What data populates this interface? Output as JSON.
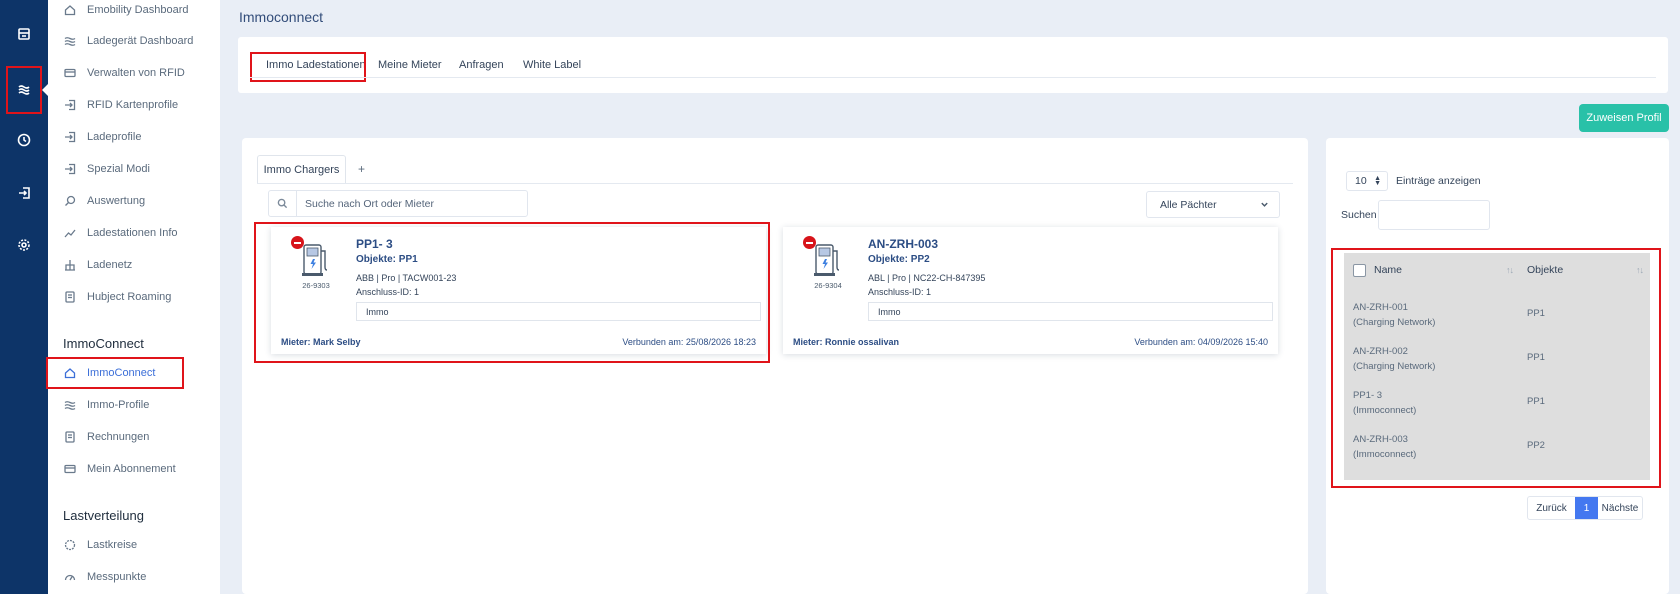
{
  "sidebar": {
    "items": [
      {
        "label": "Emobility Dashboard",
        "icon": "home-icon"
      },
      {
        "label": "Ladegerät Dashboard",
        "icon": "waves-icon"
      },
      {
        "label": "Verwalten von RFID",
        "icon": "card-icon"
      },
      {
        "label": "RFID Kartenprofile",
        "icon": "login-icon"
      },
      {
        "label": "Ladeprofile",
        "icon": "login-icon"
      },
      {
        "label": "Spezial Modi",
        "icon": "login-icon"
      },
      {
        "label": "Auswertung",
        "icon": "search-icon"
      },
      {
        "label": "Ladestationen Info",
        "icon": "trend-icon"
      },
      {
        "label": "Ladenetz",
        "icon": "network-icon"
      },
      {
        "label": "Hubject Roaming",
        "icon": "document-icon"
      }
    ],
    "immo_section": "ImmoConnect",
    "immo_items": [
      {
        "label": "ImmoConnect",
        "icon": "home-icon"
      },
      {
        "label": "Immo-Profile",
        "icon": "waves-icon"
      },
      {
        "label": "Rechnungen",
        "icon": "document-icon"
      },
      {
        "label": "Mein Abonnement",
        "icon": "card-icon"
      }
    ],
    "last_section": "Lastverteilung",
    "last_items": [
      {
        "label": "Lastkreise",
        "icon": "circle-icon"
      },
      {
        "label": "Messpunkte",
        "icon": "gauge-icon"
      }
    ]
  },
  "page": {
    "title": "Immoconnect"
  },
  "tabs": [
    "Immo Ladestationen",
    "Meine Mieter",
    "Anfragen",
    "White Label"
  ],
  "assign_button": "Zuweisen Profil",
  "main": {
    "tab": "Immo Chargers",
    "tab_add": "+",
    "search_placeholder": "Suche nach Ort oder Mieter",
    "filter": "Alle Pächter"
  },
  "chargers": [
    {
      "id": "26-9303",
      "title": "PP1- 3",
      "objects": "Objekte: PP1",
      "model": "ABB | Pro | TACW001-23",
      "connection": "Anschluss-ID: 1",
      "tag": "Immo",
      "tenant": "Mieter: Mark Selby",
      "connected": "Verbunden am: 25/08/2026 18:23"
    },
    {
      "id": "26-9304",
      "title": "AN-ZRH-003",
      "objects": "Objekte: PP2",
      "model": "ABL | Pro | NC22-CH-847395",
      "connection": "Anschluss-ID: 1",
      "tag": "Immo",
      "tenant": "Mieter: Ronnie ossalivan",
      "connected": "Verbunden am: 04/09/2026 15:40"
    }
  ],
  "right": {
    "page_size": "10",
    "page_size_label": "Einträge anzeigen",
    "search_label": "Suchen",
    "columns": [
      "Name",
      "Objekte"
    ],
    "rows": [
      {
        "name": "AN-ZRH-001",
        "sub": "(Charging Network)",
        "object": "PP1"
      },
      {
        "name": "AN-ZRH-002",
        "sub": "(Charging Network)",
        "object": "PP1"
      },
      {
        "name": "PP1- 3",
        "sub": "(Immoconnect)",
        "object": "PP1"
      },
      {
        "name": "AN-ZRH-003",
        "sub": "(Immoconnect)",
        "object": "PP2"
      }
    ],
    "pager": {
      "prev": "Zurück",
      "current": "1",
      "next": "Nächste"
    }
  },
  "colors": {
    "rail": "#0d3468",
    "accent": "#3c6fd8",
    "assign": "#29c1a8",
    "highlight": "#e0141a"
  }
}
